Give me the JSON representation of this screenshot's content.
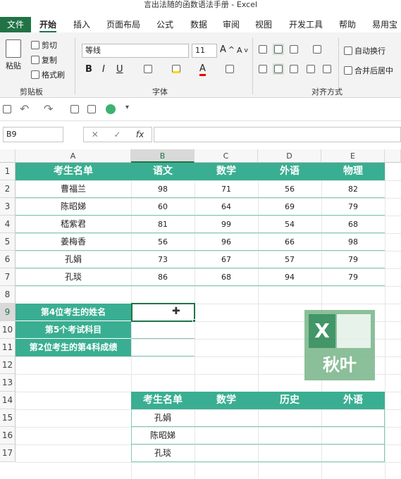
{
  "window": {
    "title": "言出法随的函数语法手册  -  Excel"
  },
  "ribbon_tabs": [
    "文件",
    "开始",
    "插入",
    "页面布局",
    "公式",
    "数据",
    "审阅",
    "视图",
    "开发工具",
    "帮助",
    "易用宝"
  ],
  "ribbon": {
    "clipboard": {
      "paste": "粘贴",
      "cut": "剪切",
      "copy": "复制",
      "format_painter": "格式刷",
      "group_label": "剪贴板"
    },
    "font": {
      "font_name": "等线",
      "font_size": "11",
      "bold": "B",
      "italic": "I",
      "underline": "U",
      "group_label": "字体"
    },
    "alignment": {
      "wrap": "自动换行",
      "merge": "合并后居中",
      "group_label": "对齐方式"
    }
  },
  "formula_bar": {
    "name_box": "B9",
    "fx": "fx",
    "cancel": "✕",
    "enter": "✓",
    "formula": ""
  },
  "columns": [
    "A",
    "B",
    "C",
    "D",
    "E"
  ],
  "rows": [
    "1",
    "2",
    "3",
    "4",
    "5",
    "6",
    "7",
    "8",
    "9",
    "10",
    "11",
    "12",
    "13",
    "14",
    "15",
    "16",
    "17"
  ],
  "table1": {
    "headers": [
      "考生名单",
      "语文",
      "数学",
      "外语",
      "物理"
    ],
    "rows": [
      [
        "曹福兰",
        "98",
        "71",
        "56",
        "82"
      ],
      [
        "陈昭娣",
        "60",
        "64",
        "69",
        "79"
      ],
      [
        "嵇紫君",
        "81",
        "99",
        "54",
        "68"
      ],
      [
        "姜梅香",
        "56",
        "96",
        "66",
        "98"
      ],
      [
        "孔娟",
        "73",
        "67",
        "57",
        "79"
      ],
      [
        "孔琰",
        "86",
        "68",
        "94",
        "79"
      ]
    ]
  },
  "lookup": {
    "labels": [
      "第4位考生的姓名",
      "第5个考试科目",
      "第2位考生的第4科成绩"
    ],
    "values": [
      "",
      "",
      ""
    ]
  },
  "table2": {
    "headers": [
      "考生名单",
      "数学",
      "历史",
      "外语"
    ],
    "rows": [
      "孔娟",
      "陈昭娣",
      "孔琰"
    ]
  },
  "watermark": {
    "text": "秋叶",
    "letter": "X"
  },
  "colors": {
    "accent": "#217346",
    "header_fill": "#3aae92"
  }
}
